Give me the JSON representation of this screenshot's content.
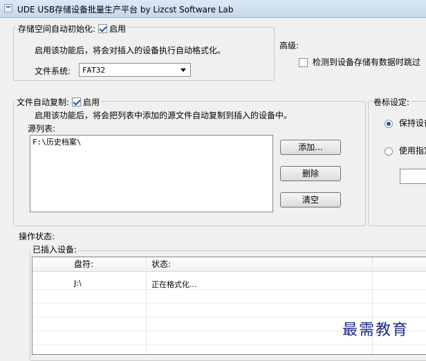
{
  "window": {
    "title": "UDE USB存储设备批量生产平台    by Lizcst Software Lab"
  },
  "storage_group": {
    "legend": "存储空间自动初始化:",
    "enable_label": "启用",
    "enabled": true,
    "description": "启用该功能后，将会对插入的设备执行自动格式化。",
    "fs_label": "文件系统:",
    "fs_value": "FAT32"
  },
  "advanced": {
    "label": "高级:",
    "check_label": "检测到设备存储有数据时跳过",
    "checked": false
  },
  "copy_group": {
    "legend": "文件自动复制:",
    "enable_label": "启用",
    "enabled": true,
    "description": "启用该功能后，将会把列表中添加的源文件自动复制到插入的设备中。",
    "source_label": "源列表:",
    "source_items": [
      "F:\\历史档案\\"
    ],
    "add_button": "添加...",
    "delete_button": "删除",
    "clear_button": "清空"
  },
  "volume_group": {
    "legend": "卷标设定:",
    "option_keep": "保持设备",
    "option_use": "使用指定",
    "selected": "keep"
  },
  "status_group": {
    "legend": "操作状态:",
    "inserted_label": "已插入设备:",
    "columns": [
      "盘符:",
      "状态:"
    ],
    "rows": [
      {
        "drive": "J:\\",
        "status": "正在格式化..."
      }
    ]
  },
  "watermark": "最需教育",
  "colors": {
    "title_bar": "#c9dbef",
    "watermark": "#1b2a8a",
    "radio_dot": "#2a56a0"
  },
  "icons": [
    "app-icon",
    "checkbox-checked",
    "checkbox-unchecked",
    "radio-selected",
    "radio-unselected",
    "dropdown-arrow-icon"
  ]
}
